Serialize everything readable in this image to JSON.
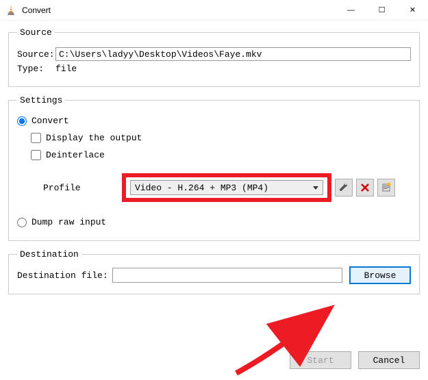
{
  "window": {
    "title": "Convert",
    "min": "—",
    "max": "☐",
    "close": "✕"
  },
  "source": {
    "legend": "Source",
    "source_label": "Source:",
    "source_value": "C:\\Users\\ladyy\\Desktop\\Videos\\Faye.mkv",
    "type_label": "Type:",
    "type_value": "file"
  },
  "settings": {
    "legend": "Settings",
    "convert_label": "Convert",
    "display_output_label": "Display the output",
    "deinterlace_label": "Deinterlace",
    "profile_label": "Profile",
    "profile_value": "Video - H.264 + MP3 (MP4)",
    "dump_label": "Dump raw input"
  },
  "destination": {
    "legend": "Destination",
    "file_label": "Destination file:",
    "browse_label": "Browse"
  },
  "footer": {
    "start_label": "Start",
    "cancel_label": "Cancel"
  },
  "icons": {
    "wrench": "wrench",
    "delete": "x",
    "new": "new"
  }
}
